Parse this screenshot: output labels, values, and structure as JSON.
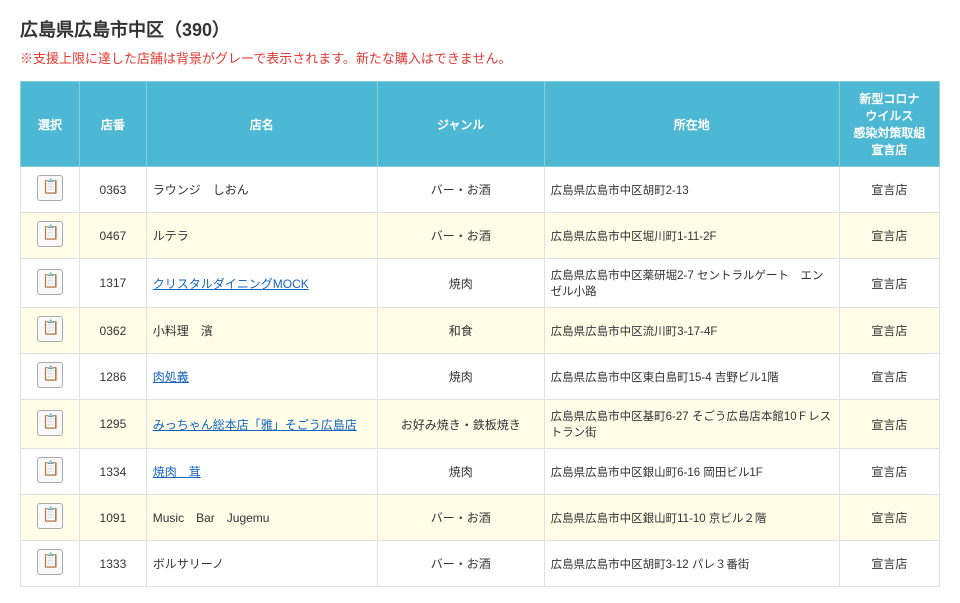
{
  "page": {
    "title": "広島県広島市中区（390）",
    "warning": "※支援上限に達した店舗は背景がグレーで表示されます。新たな購入はできません。"
  },
  "table": {
    "headers": {
      "select": "選択",
      "id": "店番",
      "name": "店名",
      "genre": "ジャンル",
      "address": "所在地",
      "covid": "新型コロナウイルス感染対策取組宣言店"
    },
    "rows": [
      {
        "id": "0363",
        "name": "ラウンジ　しおん",
        "name_link": false,
        "genre": "バー・お酒",
        "address": "広島県広島市中区胡町2-13",
        "covid": "宣言店",
        "highlight": false
      },
      {
        "id": "0467",
        "name": "ルテラ",
        "name_link": false,
        "genre": "バー・お酒",
        "address": "広島県広島市中区堀川町1-11-2F",
        "covid": "宣言店",
        "highlight": true
      },
      {
        "id": "1317",
        "name": "クリスタルダイニングMOCK",
        "name_link": true,
        "genre": "焼肉",
        "address": "広島県広島市中区薬研堀2-7 セントラルゲート　エンゼル小路",
        "covid": "宣言店",
        "highlight": false
      },
      {
        "id": "0362",
        "name": "小料理　濱",
        "name_link": false,
        "genre": "和食",
        "address": "広島県広島市中区流川町3-17-4F",
        "covid": "宣言店",
        "highlight": true
      },
      {
        "id": "1286",
        "name": "肉処義",
        "name_link": true,
        "genre": "焼肉",
        "address": "広島県広島市中区東白島町15-4 吉野ビル1階",
        "covid": "宣言店",
        "highlight": false
      },
      {
        "id": "1295",
        "name": "みっちゃん総本店「雅」そごう広島店",
        "name_link": true,
        "genre": "お好み焼き・鉄板焼き",
        "address": "広島県広島市中区基町6-27 そごう広島店本館10Ｆレストラン街",
        "covid": "宣言店",
        "highlight": true
      },
      {
        "id": "1334",
        "name": "焼肉　茸",
        "name_link": true,
        "genre": "焼肉",
        "address": "広島県広島市中区銀山町6-16 岡田ビル1F",
        "covid": "宣言店",
        "highlight": false
      },
      {
        "id": "1091",
        "name": "Music　Bar　Jugemu",
        "name_link": false,
        "genre": "バー・お酒",
        "address": "広島県広島市中区銀山町11-10 京ビル２階",
        "covid": "宣言店",
        "highlight": true
      },
      {
        "id": "1333",
        "name": "ボルサリーノ",
        "name_link": false,
        "genre": "バー・お酒",
        "address": "広島県広島市中区胡町3-12 パレ３番街",
        "covid": "宣言店",
        "highlight": false
      }
    ]
  }
}
